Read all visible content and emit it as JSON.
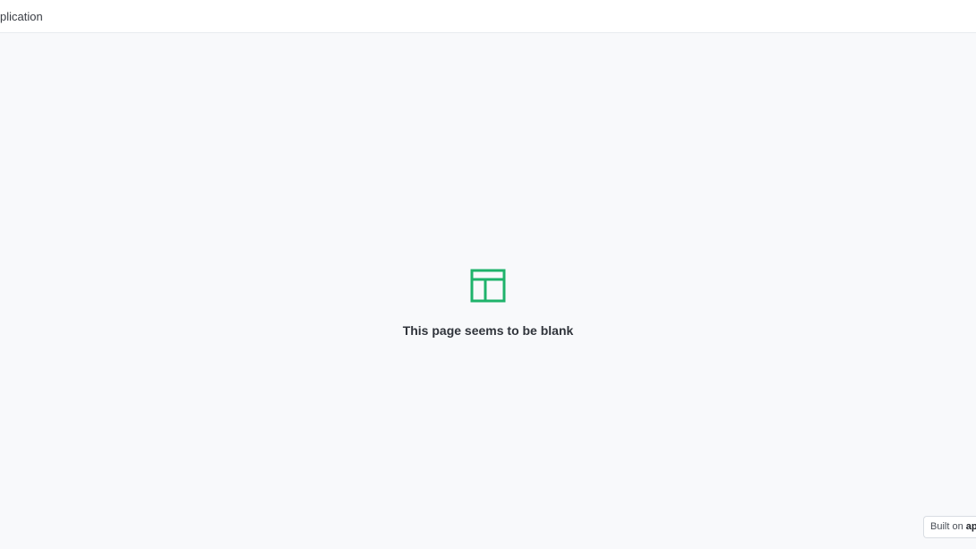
{
  "header": {
    "app_title": "plication"
  },
  "empty_state": {
    "message": "This page seems to be blank",
    "icon": "layout-icon",
    "icon_color": "#1fb36b"
  },
  "badge": {
    "prefix": "Built on",
    "brand": "ap"
  },
  "colors": {
    "background": "#f8f9fb",
    "header_background": "#ffffff",
    "accent": "#1fb36b"
  }
}
